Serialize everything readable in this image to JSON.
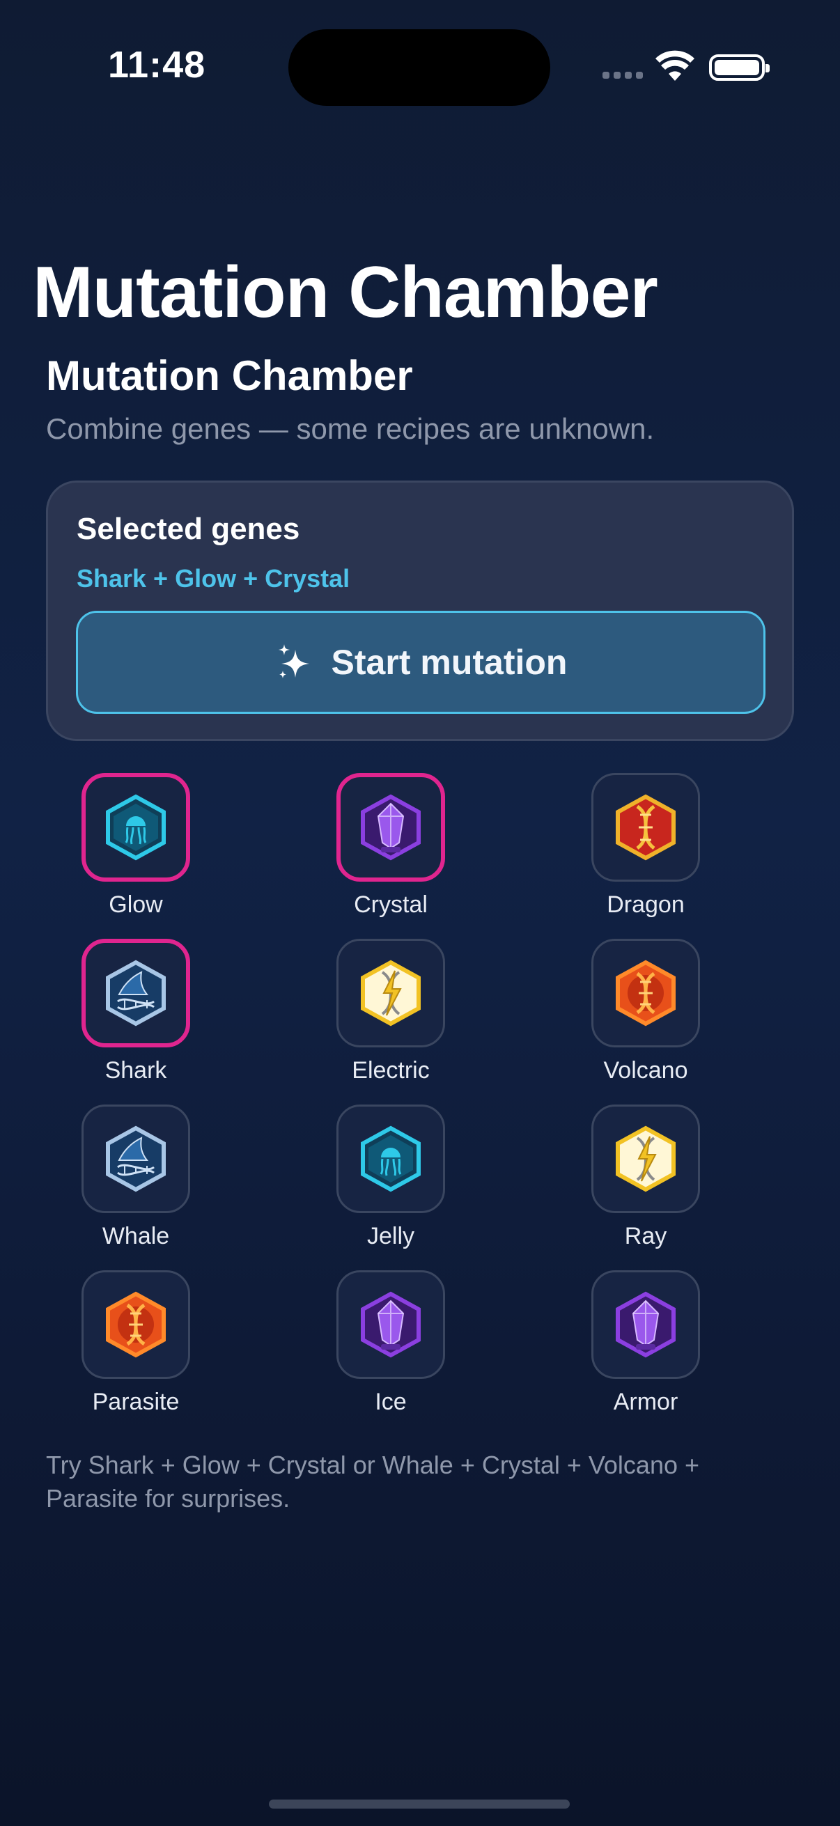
{
  "status_bar": {
    "time": "11:48"
  },
  "header": {
    "large_title": "Mutation Chamber",
    "title": "Mutation Chamber",
    "description": "Combine genes — some recipes are unknown."
  },
  "selection": {
    "title": "Selected genes",
    "combo": "Shark + Glow + Crystal",
    "start_label": "Start mutation"
  },
  "genes": [
    {
      "label": "Glow",
      "icon": "jellyfish-icon",
      "selected": true,
      "color": "#2ec9e8"
    },
    {
      "label": "Crystal",
      "icon": "crystal-icon",
      "selected": true,
      "color": "#8b3fe0"
    },
    {
      "label": "Dragon",
      "icon": "dragon-dna-icon",
      "selected": false,
      "color": "#c8261e"
    },
    {
      "label": "Shark",
      "icon": "shark-dna-icon",
      "selected": true,
      "color": "#2b6aa8"
    },
    {
      "label": "Electric",
      "icon": "lightning-dna-icon",
      "selected": false,
      "color": "#f2c224"
    },
    {
      "label": "Volcano",
      "icon": "volcano-dna-icon",
      "selected": false,
      "color": "#e8501a"
    },
    {
      "label": "Whale",
      "icon": "shark-dna-icon",
      "selected": false,
      "color": "#2b6aa8"
    },
    {
      "label": "Jelly",
      "icon": "jellyfish-icon",
      "selected": false,
      "color": "#2ec9e8"
    },
    {
      "label": "Ray",
      "icon": "lightning-dna-icon",
      "selected": false,
      "color": "#f2c224"
    },
    {
      "label": "Parasite",
      "icon": "volcano-dna-icon",
      "selected": false,
      "color": "#e8501a"
    },
    {
      "label": "Ice",
      "icon": "crystal-icon",
      "selected": false,
      "color": "#8b3fe0"
    },
    {
      "label": "Armor",
      "icon": "crystal-icon",
      "selected": false,
      "color": "#8b3fe0"
    }
  ],
  "hint": "Try Shark + Glow + Crystal or Whale + Crystal + Volcano + Parasite for surprises.",
  "colors": {
    "accent": "#4ec3ea",
    "selection_ring": "#e0258f",
    "card": "#2a3450"
  }
}
